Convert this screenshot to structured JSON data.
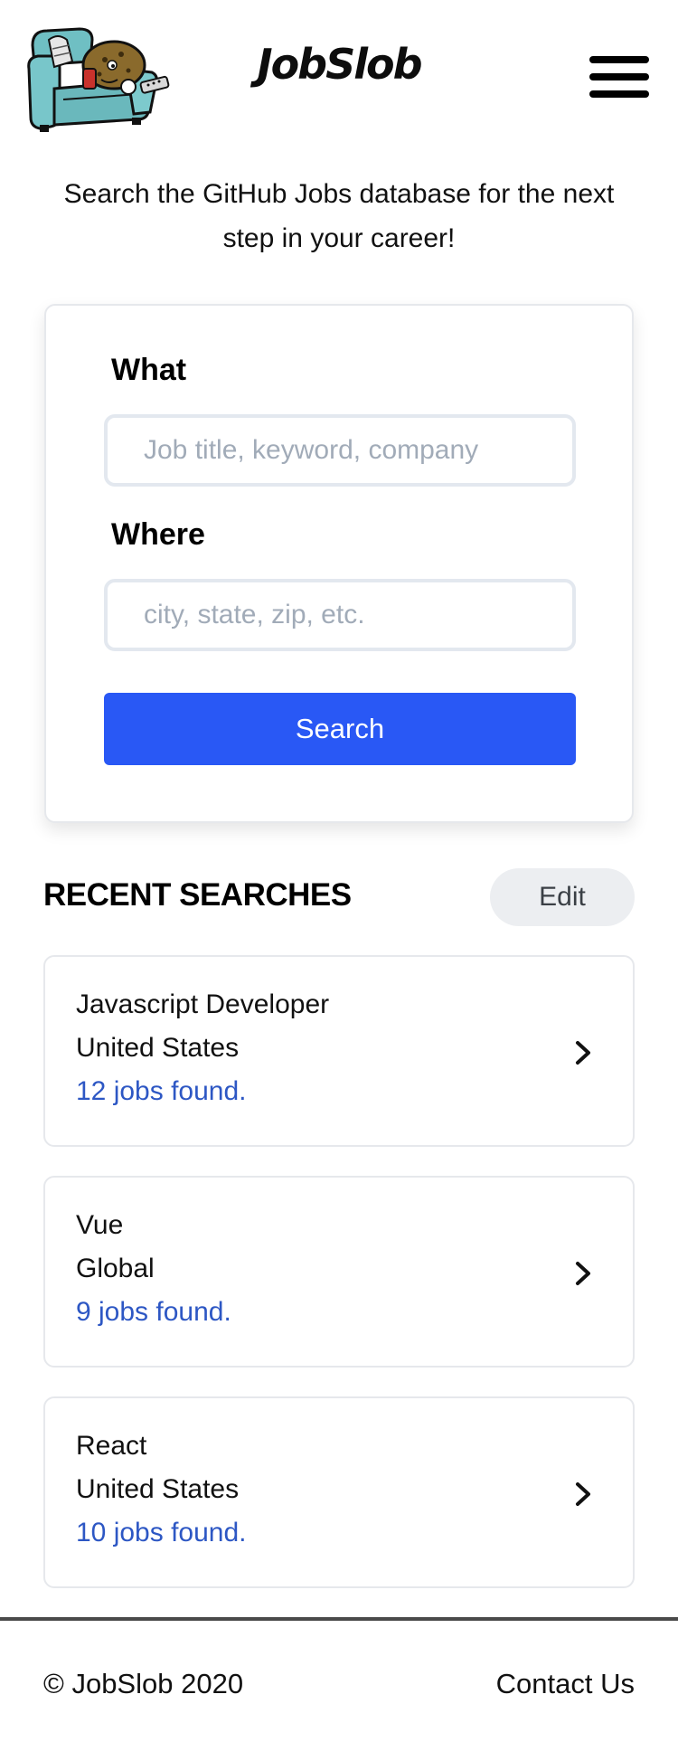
{
  "header": {
    "brand": "JobSlob",
    "logo_icon": "couch-potato-logo-icon",
    "menu_icon": "hamburger-menu-icon"
  },
  "intro": "Search the GitHub Jobs database for the next step in your career!",
  "search_form": {
    "what_label": "What",
    "what_placeholder": "Job title, keyword, company",
    "what_value": "",
    "where_label": "Where",
    "where_placeholder": "city, state, zip, etc.",
    "where_value": "",
    "search_label": "Search"
  },
  "recent": {
    "title": "RECENT SEARCHES",
    "edit_label": "Edit",
    "items": [
      {
        "query": "Javascript Developer",
        "location": "United States",
        "count": "12 jobs found."
      },
      {
        "query": "Vue",
        "location": "Global",
        "count": "9 jobs found."
      },
      {
        "query": "React",
        "location": "United States",
        "count": "10 jobs found."
      }
    ]
  },
  "footer": {
    "copyright": "© JobSlob 2020",
    "contact": "Contact Us"
  },
  "colors": {
    "accent": "#2958f5",
    "link": "#2d57c4",
    "edit_bg": "#eceef1",
    "border": "#e6e8ec"
  }
}
